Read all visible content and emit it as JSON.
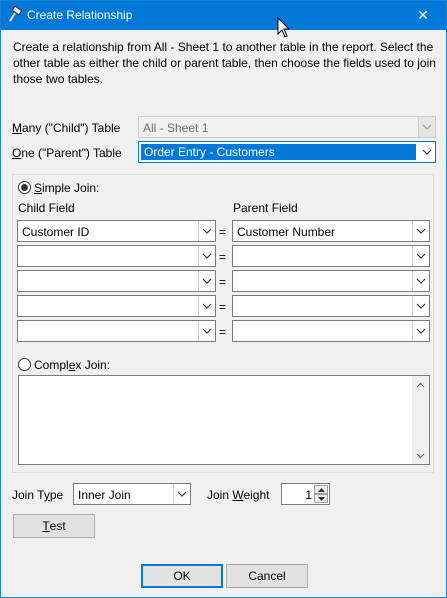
{
  "window": {
    "title": "Create Relationship",
    "close_glyph": "✕"
  },
  "intro_text": "Create a relationship from All - Sheet 1 to another table in the report. Select the other table as either the child or parent table, then choose the fields used to join those two tables.",
  "many_table": {
    "label_prefix": "",
    "label_accel": "M",
    "label_rest": "any (\"Child\") Table",
    "value": "All - Sheet 1"
  },
  "one_table": {
    "label_accel": "O",
    "label_rest": "ne (\"Parent\") Table",
    "value": "Order Entry - Customers"
  },
  "simple_join": {
    "label_accel": "S",
    "label_rest": "imple Join:",
    "selected": true,
    "child_header": "Child Field",
    "parent_header": "Parent Field",
    "equals": "=",
    "rows": [
      {
        "child": "Customer ID",
        "parent": "Customer Number"
      },
      {
        "child": "",
        "parent": ""
      },
      {
        "child": "",
        "parent": ""
      },
      {
        "child": "",
        "parent": ""
      },
      {
        "child": "",
        "parent": ""
      }
    ]
  },
  "complex_join": {
    "label_pre": "Compl",
    "label_accel": "e",
    "label_rest": "x Join:",
    "selected": false,
    "text": ""
  },
  "join_type": {
    "label_pre": "Join T",
    "label_accel": "y",
    "label_rest": "pe",
    "value": "Inner Join"
  },
  "join_weight": {
    "label_pre": "Join ",
    "label_accel": "W",
    "label_rest": "eight",
    "value": "1"
  },
  "buttons": {
    "test_accel": "T",
    "test_rest": "est",
    "ok": "OK",
    "cancel": "Cancel"
  },
  "colors": {
    "titlebar": "#0078d7",
    "selection": "#0078d7",
    "dialog_bg": "#f0f0f0"
  },
  "icons": {
    "app": "gavel-icon",
    "close": "close-icon",
    "dropdown": "chevron-down-icon"
  }
}
